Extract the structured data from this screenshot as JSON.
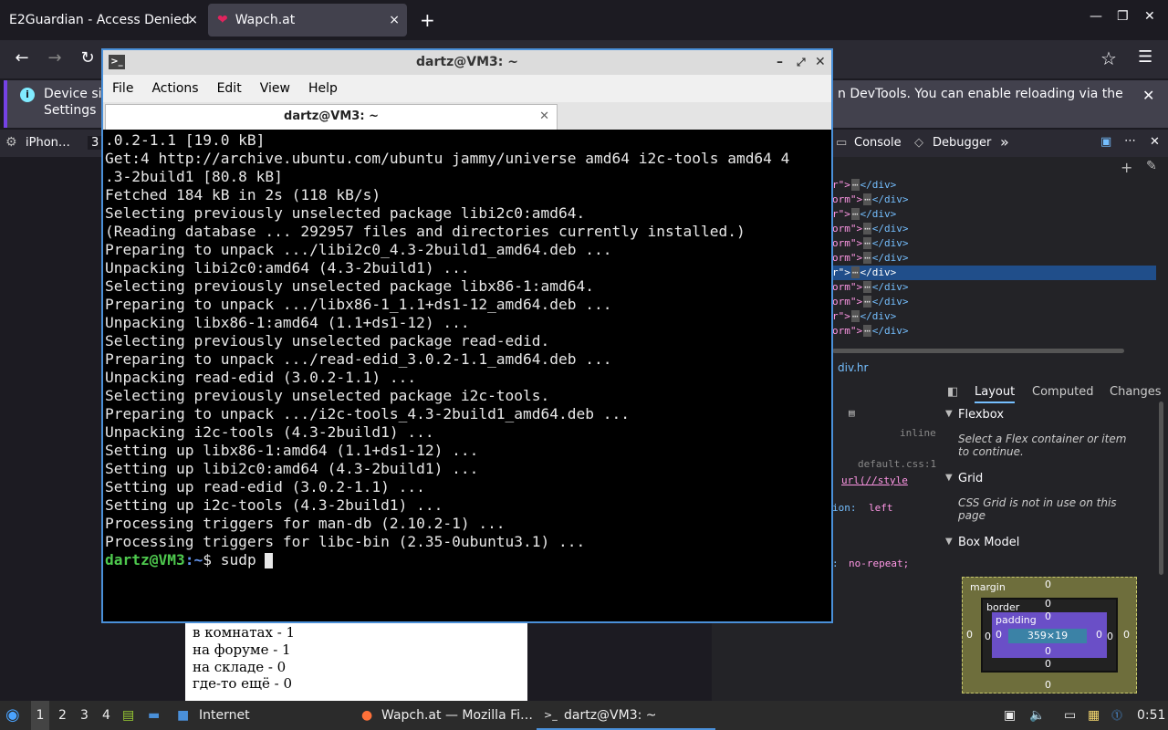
{
  "browser": {
    "tabs": [
      {
        "title": "E2Guardian - Access Denied",
        "close": "×"
      },
      {
        "title": "Wapch.at",
        "close": "×"
      }
    ],
    "new_tab": "+",
    "window_controls": {
      "minimize": "—",
      "maximize": "❐",
      "close": "✕"
    },
    "nav": {
      "back": "←",
      "forward": "→",
      "reload": "↻"
    },
    "infobar": {
      "text_left": "Device si",
      "text_left2": "Settings m",
      "text_right": "n DevTools. You can enable reloading via the",
      "close": "✕"
    }
  },
  "devtools": {
    "device": "iPhon…",
    "device_num": "3",
    "tabs": [
      "Console",
      "Debugger"
    ],
    "more": "»",
    "inspector_rows": [
      {
        "pre": "r\">",
        "mid": "⋯",
        "post": "</div>",
        "selected": false
      },
      {
        "pre": "orm\">",
        "mid": "⋯",
        "post": "</div>",
        "selected": false
      },
      {
        "pre": "r\">",
        "mid": "⋯",
        "post": "</div>",
        "selected": false
      },
      {
        "pre": "orm\">",
        "mid": "⋯",
        "post": "</div>",
        "selected": false
      },
      {
        "pre": "orm\">",
        "mid": "⋯",
        "post": "</div>",
        "selected": false
      },
      {
        "pre": "orm\">",
        "mid": "⋯",
        "post": "</div>",
        "selected": false
      },
      {
        "pre": "r\">",
        "mid": "⋯",
        "post": "</div>",
        "selected": true
      },
      {
        "pre": "orm\">",
        "mid": "⋯",
        "post": "</div>",
        "selected": false
      },
      {
        "pre": "orm\">",
        "mid": "⋯",
        "post": "</div>",
        "selected": false
      },
      {
        "pre": "r\">",
        "mid": "⋯",
        "post": "</div>",
        "selected": false
      },
      {
        "pre": "orm\">",
        "mid": "⋯",
        "post": "</div>",
        "selected": false
      }
    ],
    "breadcrumb": "div.hr",
    "rules": {
      "inline": "inline",
      "source": "default.css:1",
      "url": "url(//style",
      "prop1": "ion:",
      "val1": "left",
      "prop2": ":",
      "val2": "no-repeat;"
    },
    "layout_tabs": [
      "Layout",
      "Computed",
      "Changes"
    ],
    "flexbox": {
      "title": "Flexbox",
      "text": "Select a Flex container or item to continue."
    },
    "grid": {
      "title": "Grid",
      "text": "CSS Grid is not in use on this page"
    },
    "boxmodel": {
      "title": "Box Model",
      "margin_label": "margin",
      "border_label": "border",
      "padding_label": "padding",
      "content": "359×19",
      "zero": "0"
    }
  },
  "terminal": {
    "title": "dartz@VM3: ~",
    "menu": [
      "File",
      "Actions",
      "Edit",
      "View",
      "Help"
    ],
    "tab_title": "dartz@VM3: ~",
    "lines": [
      ".0.2-1.1 [19.0 kB]",
      "Get:4 http://archive.ubuntu.com/ubuntu jammy/universe amd64 i2c-tools amd64 4",
      ".3-2build1 [80.8 kB]",
      "Fetched 184 kB in 2s (118 kB/s)",
      "Selecting previously unselected package libi2c0:amd64.",
      "(Reading database ... 292957 files and directories currently installed.)",
      "Preparing to unpack .../libi2c0_4.3-2build1_amd64.deb ...",
      "Unpacking libi2c0:amd64 (4.3-2build1) ...",
      "Selecting previously unselected package libx86-1:amd64.",
      "Preparing to unpack .../libx86-1_1.1+ds1-12_amd64.deb ...",
      "Unpacking libx86-1:amd64 (1.1+ds1-12) ...",
      "Selecting previously unselected package read-edid.",
      "Preparing to unpack .../read-edid_3.0.2-1.1_amd64.deb ...",
      "Unpacking read-edid (3.0.2-1.1) ...",
      "Selecting previously unselected package i2c-tools.",
      "Preparing to unpack .../i2c-tools_4.3-2build1_amd64.deb ...",
      "Unpacking i2c-tools (4.3-2build1) ...",
      "Setting up libx86-1:amd64 (1.1+ds1-12) ...",
      "Setting up libi2c0:amd64 (4.3-2build1) ...",
      "Setting up read-edid (3.0.2-1.1) ...",
      "Setting up i2c-tools (4.3-2build1) ...",
      "Processing triggers for man-db (2.10.2-1) ...",
      "Processing triggers for libc-bin (2.35-0ubuntu3.1) ..."
    ],
    "prompt_user": "dartz@VM3",
    "prompt_sep": ":",
    "prompt_path": "~",
    "prompt_dollar": "$ ",
    "input": "sudp "
  },
  "webpage": {
    "lines": [
      "в комнатах - 1",
      "на форуме - 1",
      "на складе - 0",
      "где-то ещё - 0"
    ]
  },
  "taskbar": {
    "workspaces": [
      "1",
      "2",
      "3",
      "4"
    ],
    "folder_label": "Internet",
    "windows": [
      "Wapch.at — Mozilla Fi…",
      "dartz@VM3: ~"
    ],
    "clock": "0:51"
  }
}
